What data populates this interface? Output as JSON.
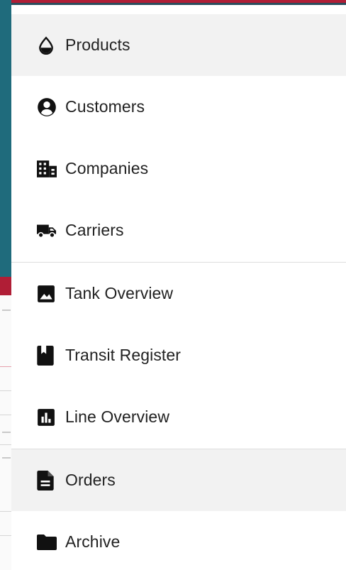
{
  "menu": {
    "items": [
      {
        "label": "Products",
        "icon": "water-drop-icon"
      },
      {
        "label": "Customers",
        "icon": "user-circle-icon"
      },
      {
        "label": "Companies",
        "icon": "building-icon"
      },
      {
        "label": "Carriers",
        "icon": "truck-icon"
      },
      {
        "label": "Tank Overview",
        "icon": "image-icon"
      },
      {
        "label": "Transit Register",
        "icon": "bookmark-book-icon"
      },
      {
        "label": "Line Overview",
        "icon": "bar-chart-icon"
      },
      {
        "label": "Orders",
        "icon": "document-icon"
      },
      {
        "label": "Archive",
        "icon": "folder-icon"
      }
    ]
  },
  "colors": {
    "accent_red": "#b01e36",
    "background_teal": "#1f6b7c",
    "active_item_bg": "#f2f2f2",
    "icon_color": "#111111"
  }
}
